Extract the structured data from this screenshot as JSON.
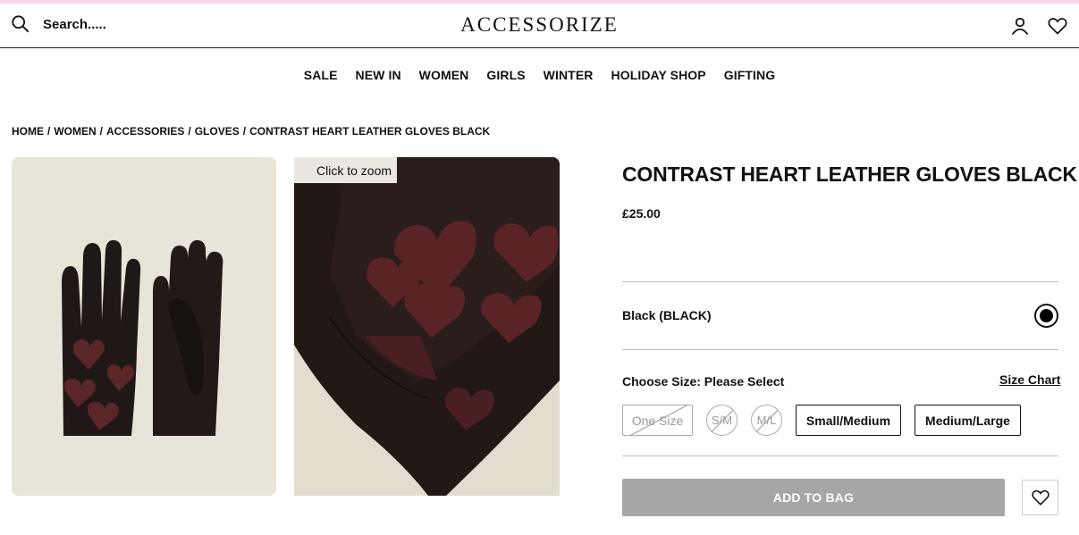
{
  "header": {
    "search_placeholder": "Search.....",
    "logo": "ACCESSORIZE",
    "icons": [
      "search-icon",
      "account-icon",
      "wishlist-heart-icon"
    ]
  },
  "nav": {
    "items": [
      "SALE",
      "NEW IN",
      "WOMEN",
      "GIRLS",
      "WINTER",
      "HOLIDAY SHOP",
      "GIFTING"
    ]
  },
  "breadcrumb": {
    "items": [
      "HOME",
      "WOMEN",
      "ACCESSORIES",
      "GLOVES"
    ],
    "separator": "/",
    "current": "CONTRAST HEART LEATHER GLOVES BLACK"
  },
  "gallery": {
    "zoom_label": "Click to zoom"
  },
  "product": {
    "title": "CONTRAST HEART LEATHER GLOVES BLACK",
    "price": "£25.00",
    "colour_label": "Black (BLACK)",
    "colour_swatch": "#000000",
    "choose_size_label": "Choose Size: Please Select",
    "size_chart_label": "Size Chart",
    "sizes": [
      {
        "label": "One Size",
        "available": false
      },
      {
        "label": "S/M",
        "available": false
      },
      {
        "label": "M/L",
        "available": false
      },
      {
        "label": "Small/Medium",
        "available": true
      },
      {
        "label": "Medium/Large",
        "available": true
      }
    ],
    "add_to_bag_label": "ADD TO BAG",
    "add_to_bag_color": "#a6a6a6"
  }
}
